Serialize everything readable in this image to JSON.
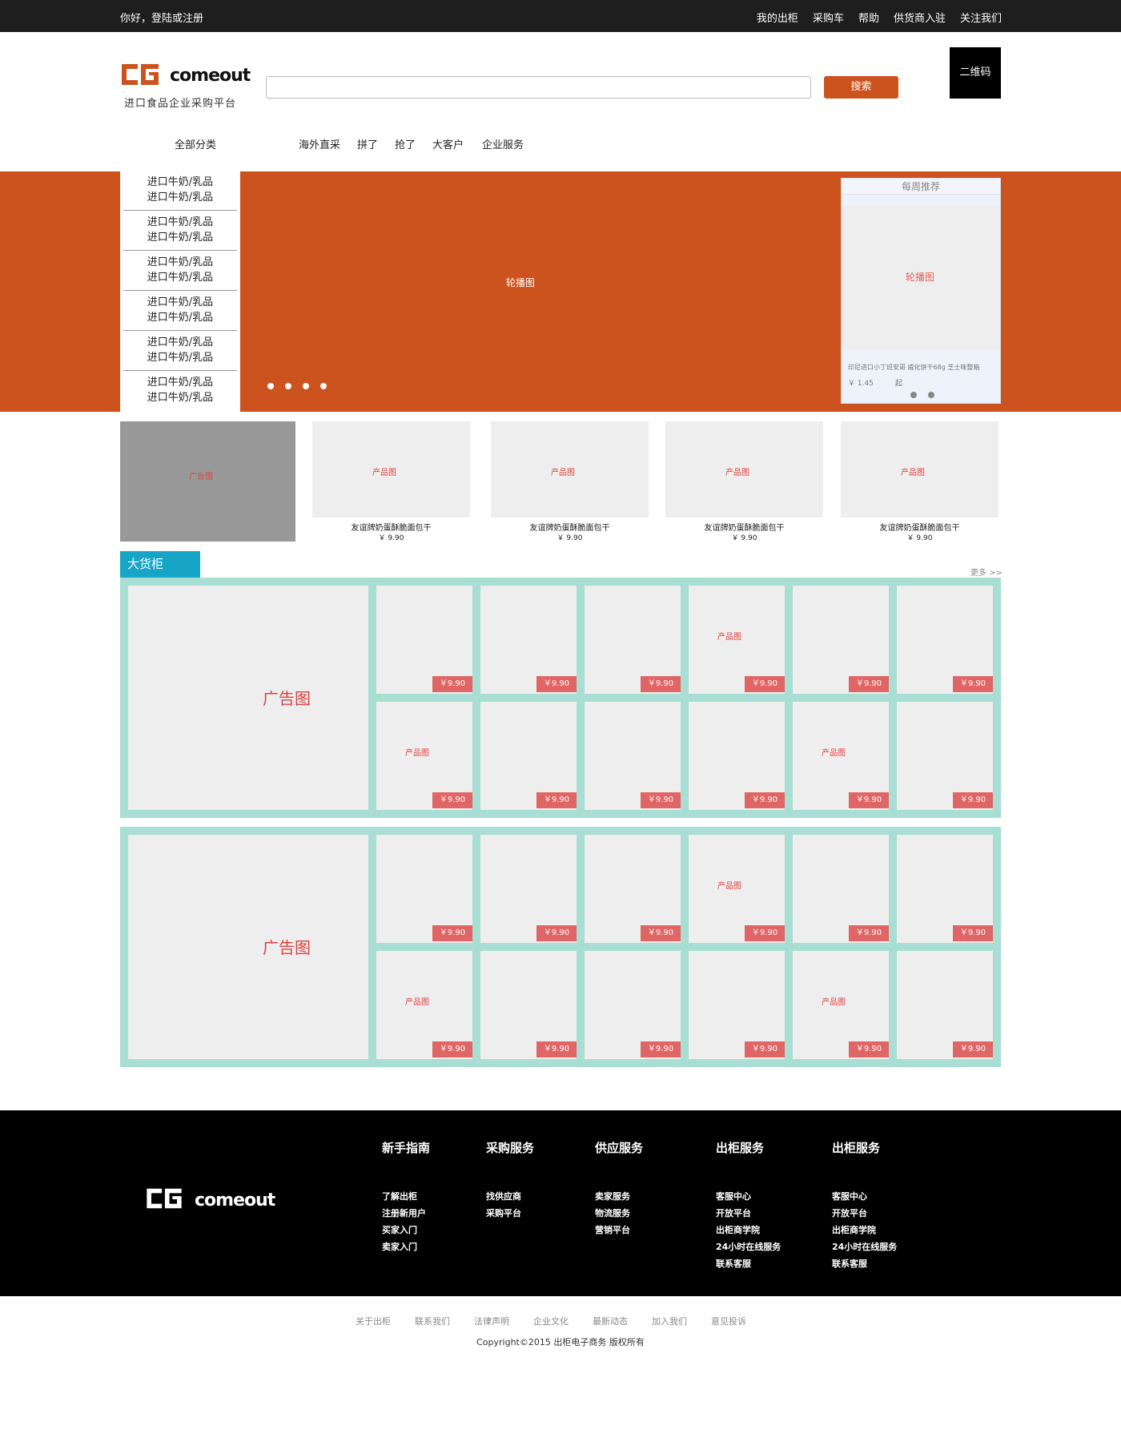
{
  "topbar": {
    "greeting": "你好，登陆或注册",
    "links": [
      "我的出柜",
      "采购车",
      "帮助",
      "供货商入驻",
      "关注我们"
    ]
  },
  "header": {
    "logo_text": "comeout",
    "tagline": "进口食品企业采购平台",
    "search_placeholder": "",
    "search_button": "搜索",
    "qr_label": "二维码",
    "accent_color": "#cc531e"
  },
  "nav": {
    "all_categories": "全部分类",
    "items": [
      "海外直采",
      "拼了",
      "抢了",
      "大客户",
      "企业服务"
    ]
  },
  "hero": {
    "label": "轮播图",
    "dot_count": 4,
    "sidebar_items": [
      [
        "进口牛奶/乳品",
        "进口牛奶/乳品"
      ],
      [
        "进口牛奶/乳品",
        "进口牛奶/乳品"
      ],
      [
        "进口牛奶/乳品",
        "进口牛奶/乳品"
      ],
      [
        "进口牛奶/乳品",
        "进口牛奶/乳品"
      ],
      [
        "进口牛奶/乳品",
        "进口牛奶/乳品"
      ],
      [
        "进口牛奶/乳品",
        "进口牛奶/乳品"
      ]
    ],
    "weekly": {
      "title": "每周推荐",
      "image_label": "轮播图",
      "product_name": "印尼进口小丁班安哥 威化饼干68g 芝士味整箱",
      "price": "￥ 1.45",
      "unit": "起"
    }
  },
  "ad_row": {
    "ad_label": "广告图",
    "products": [
      {
        "img": "产品图",
        "name": "友谊牌奶蛋酥脆面包干",
        "price": "￥ 9.90"
      },
      {
        "img": "产品图",
        "name": "友谊牌奶蛋酥脆面包干",
        "price": "￥ 9.90"
      },
      {
        "img": "产品图",
        "name": "友谊牌奶蛋酥脆面包干",
        "price": "￥ 9.90"
      },
      {
        "img": "产品图",
        "name": "友谊牌奶蛋酥脆面包干",
        "price": "￥ 9.90"
      }
    ]
  },
  "cabinet": {
    "title": "大货柜",
    "more": "更多 >>",
    "ad_label": "广告图",
    "product_label": "产品图",
    "price": "￥9.90"
  },
  "footer": {
    "logo_text": "comeout",
    "columns": [
      {
        "title": "新手指南",
        "links": [
          "了解出柜",
          "注册新用户",
          "买家入门",
          "卖家入门"
        ]
      },
      {
        "title": "采购服务",
        "links": [
          "找供应商",
          "采购平台"
        ]
      },
      {
        "title": "供应服务",
        "links": [
          "卖家服务",
          "物流服务",
          "营销平台"
        ]
      },
      {
        "title": "出柜服务",
        "links": [
          "客服中心",
          "开放平台",
          "出柜商学院",
          "24小时在线服务",
          "联系客服"
        ]
      },
      {
        "title": "出柜服务",
        "links": [
          "客服中心",
          "开放平台",
          "出柜商学院",
          "24小时在线服务",
          "联系客服"
        ]
      }
    ],
    "bottom_links": [
      "关于出柜",
      "联系我们",
      "法律声明",
      "企业文化",
      "最新动态",
      "加入我们",
      "意见投诉"
    ],
    "copyright": "Copyright©2015   出柜电子商务 版权所有"
  }
}
